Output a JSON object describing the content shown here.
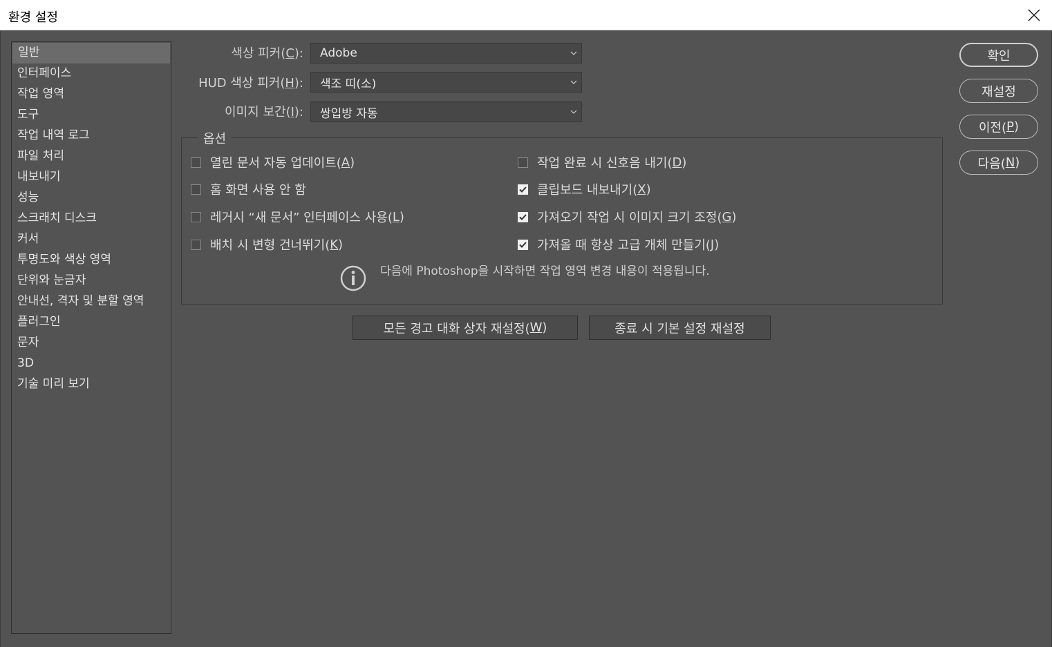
{
  "window": {
    "title": "환경 설정"
  },
  "sidebar": {
    "items": [
      "일반",
      "인터페이스",
      "작업 영역",
      "도구",
      "작업 내역 로그",
      "파일 처리",
      "내보내기",
      "성능",
      "스크래치 디스크",
      "커서",
      "투명도와 색상 영역",
      "단위와 눈금자",
      "안내선, 격자 및 분할 영역",
      "플러그인",
      "문자",
      "3D",
      "기술 미리 보기"
    ],
    "selected": "일반"
  },
  "fields": {
    "color_picker": {
      "label_pre": "색상 피커(",
      "label_key": "C",
      "label_post": "):",
      "value": "Adobe"
    },
    "hud_color_picker": {
      "label_pre": "HUD 색상 피커(",
      "label_key": "H",
      "label_post": "):",
      "value": "색조 띠(소)"
    },
    "image_interpolation": {
      "label_pre": "이미지 보간(",
      "label_key": "I",
      "label_post": "):",
      "value": "쌍입방 자동"
    }
  },
  "options": {
    "legend": "옵션",
    "items": [
      {
        "pre": "열린 문서 자동 업데이트(",
        "key": "A",
        "post": ")",
        "checked": false
      },
      {
        "pre": "홈 화면 사용 안 함",
        "key": "",
        "post": "",
        "checked": false
      },
      {
        "pre": "레거시 “새 문서” 인터페이스 사용(",
        "key": "L",
        "post": ")",
        "checked": false
      },
      {
        "pre": "배치 시 변형 건너뛰기(",
        "key": "K",
        "post": ")",
        "checked": false
      },
      {
        "pre": "작업 완료 시 신호음 내기(",
        "key": "D",
        "post": ")",
        "checked": false
      },
      {
        "pre": "클립보드 내보내기(",
        "key": "X",
        "post": ")",
        "checked": true
      },
      {
        "pre": "가져오기 작업 시 이미지 크기 조정(",
        "key": "G",
        "post": ")",
        "checked": true
      },
      {
        "pre": "가져올 때 항상 고급 개체 만들기(",
        "key": "J",
        "post": ")",
        "checked": true
      }
    ],
    "info": "다음에 Photoshop을 시작하면 작업 영역 변경 내용이 적용됩니다."
  },
  "buttons": {
    "reset_warnings": {
      "pre": "모든 경고 대화 상자 재설정(",
      "key": "W",
      "post": ")"
    },
    "reset_on_quit": "종료 시 기본 설정 재설정",
    "ok": "확인",
    "reset": "재설정",
    "prev": {
      "pre": "이전(",
      "key": "P",
      "post": ")"
    },
    "next": {
      "pre": "다음(",
      "key": "N",
      "post": ")"
    }
  },
  "icons": {
    "close": "close-icon",
    "dropdown": "chevron-down-icon",
    "info": "info-icon",
    "check": "checkmark-icon"
  }
}
